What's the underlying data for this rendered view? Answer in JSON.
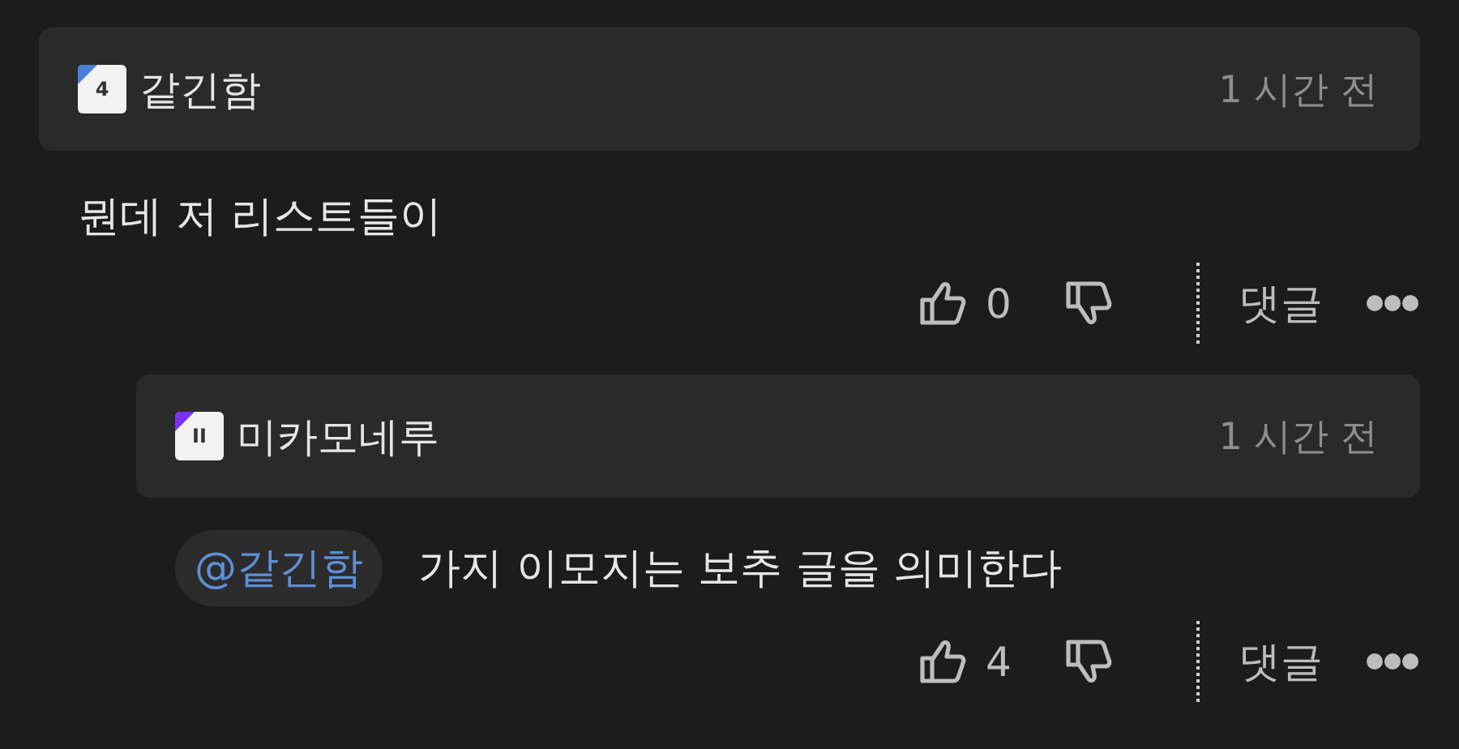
{
  "comments": [
    {
      "author": "같긴함",
      "badge": {
        "text": "4",
        "color": "#4a7fd6"
      },
      "time": "1 시간 전",
      "body": "뭔데 저 리스트들이",
      "likes": "0",
      "reply_label": "댓글",
      "children": [
        {
          "author": "미카모네루",
          "badge": {
            "text": "II",
            "color": "#7b2ff7"
          },
          "time": "1 시간 전",
          "mention": "@같긴함",
          "body": "가지 이모지는 보추 글을 의미한다",
          "likes": "4",
          "reply_label": "댓글"
        }
      ]
    }
  ]
}
